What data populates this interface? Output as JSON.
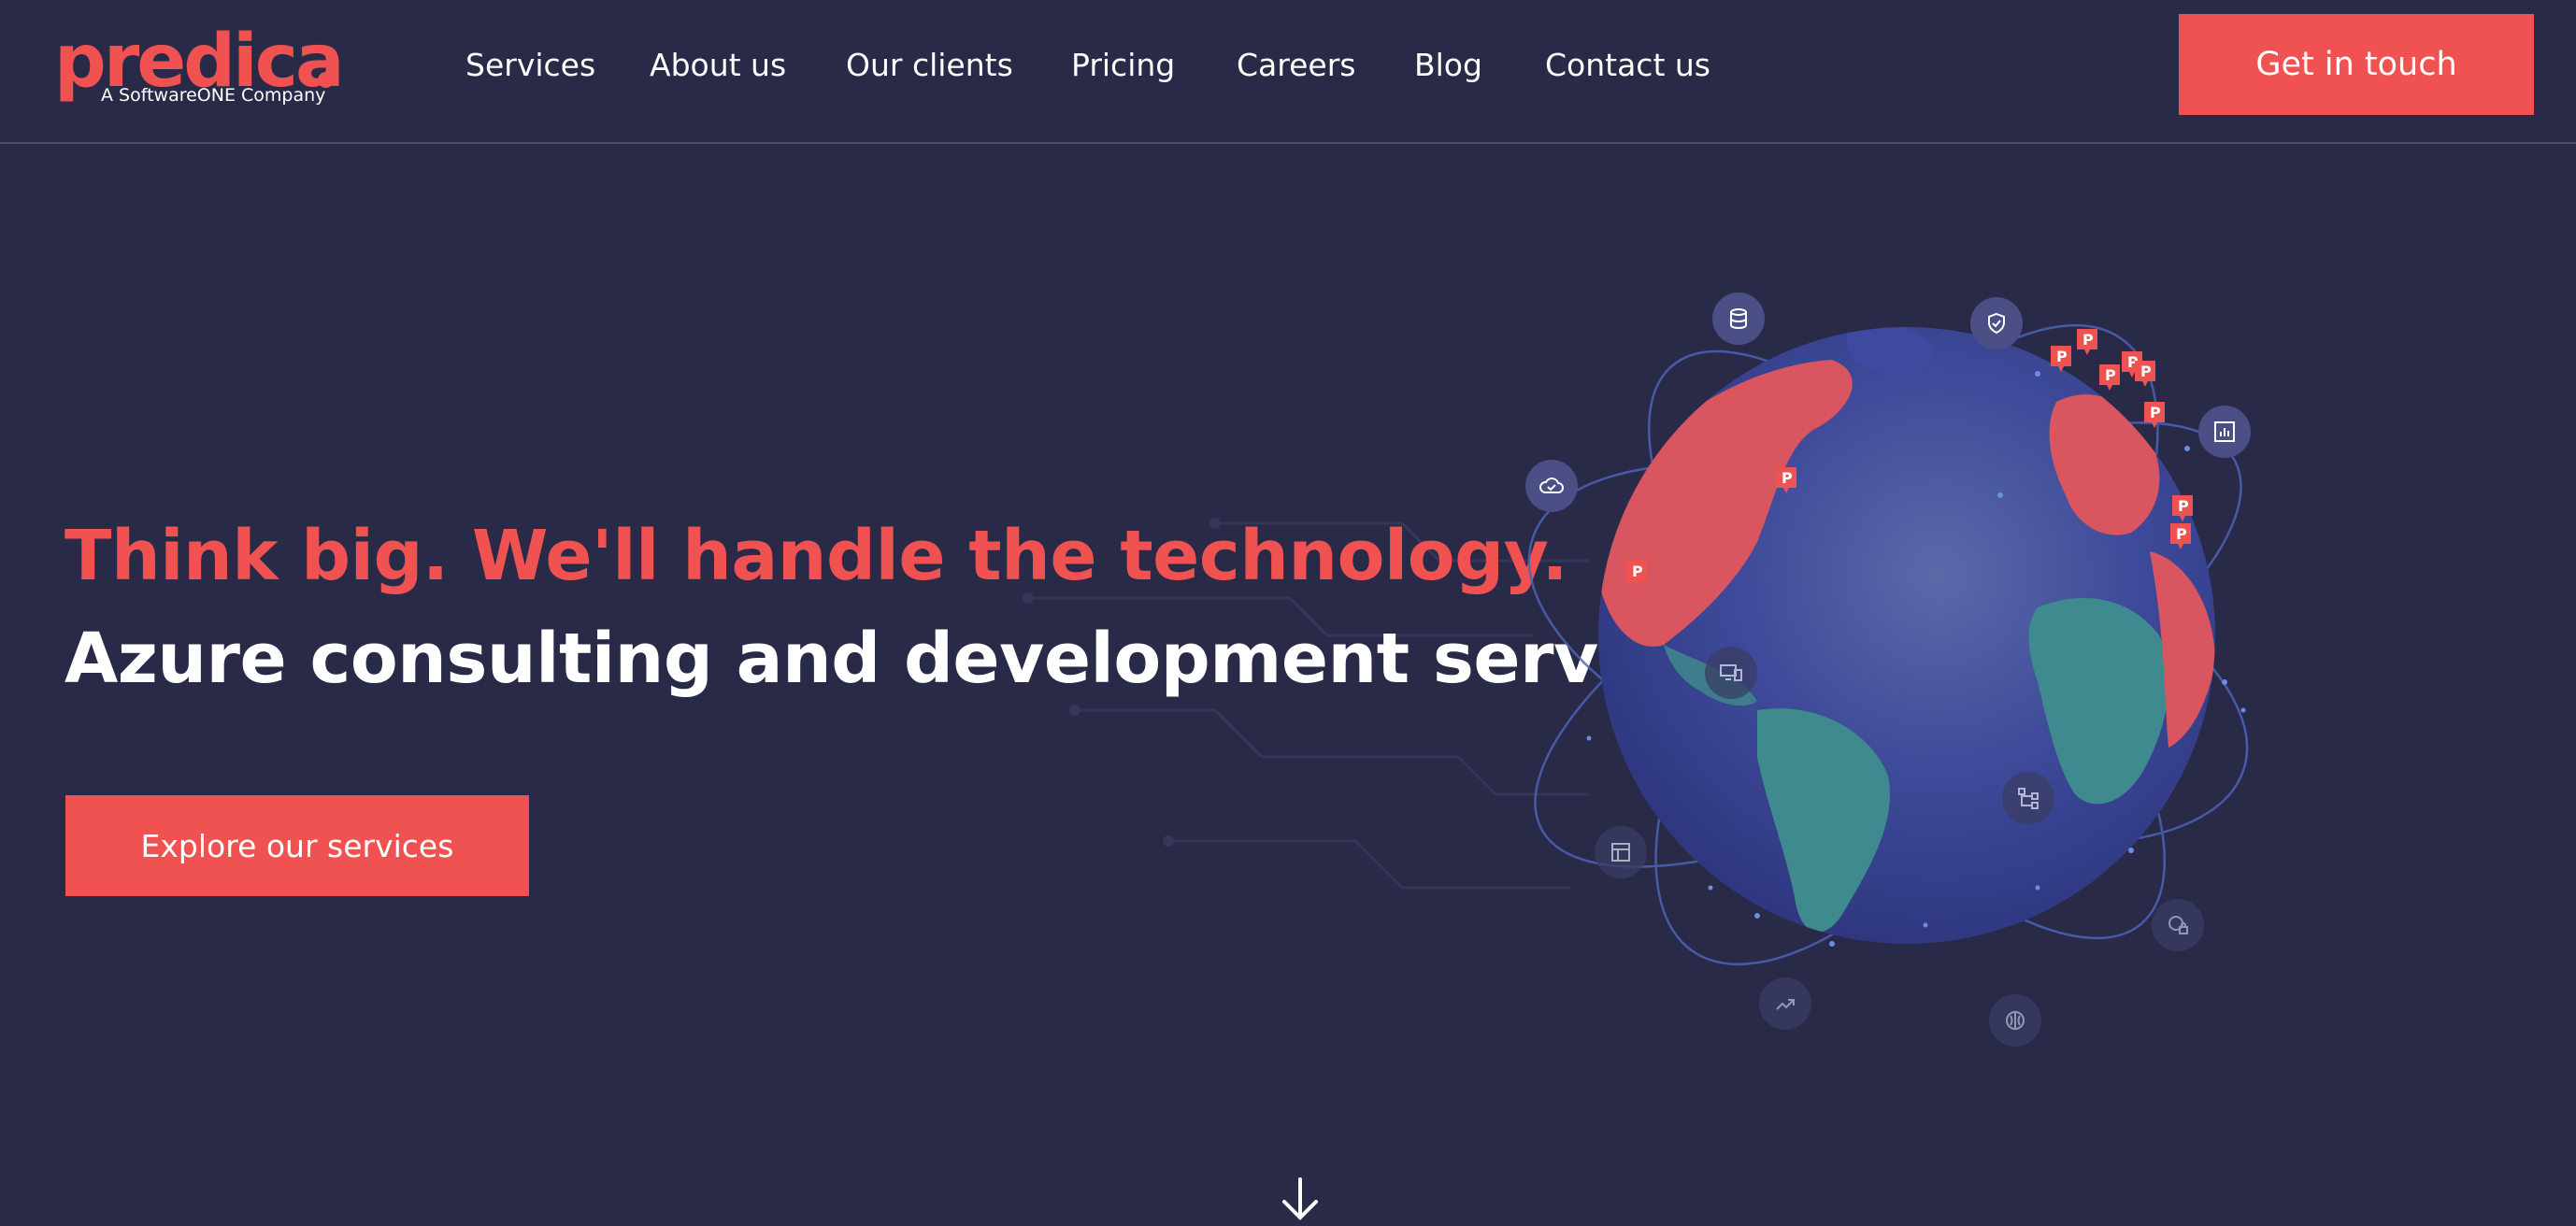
{
  "brand": {
    "logo_text": "predica",
    "tagline": "A SoftwareONE Company",
    "accent_color": "#f05252",
    "background_color": "#282a47"
  },
  "nav": {
    "items": [
      {
        "label": "Services"
      },
      {
        "label": "About us"
      },
      {
        "label": "Our clients"
      },
      {
        "label": "Pricing"
      },
      {
        "label": "Careers"
      },
      {
        "label": "Blog"
      },
      {
        "label": "Contact us"
      }
    ],
    "cta_label": "Get in touch"
  },
  "hero": {
    "headline_red": "Think big. We'll handle the technology.",
    "headline_white": "Azure consulting and development services.",
    "cta_label": "Explore our services",
    "marker_letter": "P",
    "orbit_icons": [
      "database-icon",
      "shield-check-icon",
      "bar-chart-icon",
      "cloud-check-icon",
      "devices-icon",
      "dashboard-icon",
      "flow-icon",
      "trend-icon",
      "brain-icon",
      "globe-lock-icon"
    ]
  },
  "scroll_icon": "arrow-down-icon"
}
